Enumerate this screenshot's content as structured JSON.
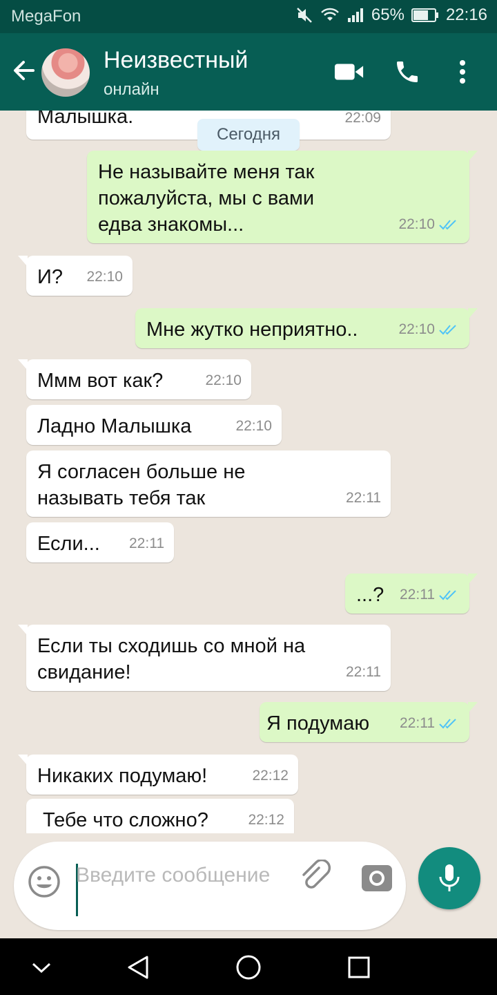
{
  "status_bar": {
    "carrier": "MegaFon",
    "battery": "65%",
    "time": "22:16"
  },
  "header": {
    "contact_name": "Неизвестный",
    "contact_status": "онлайн"
  },
  "chat": {
    "date_chip": "Сегодня",
    "messages": [
      {
        "dir": "in",
        "text": "Малышка.",
        "time": "22:09"
      },
      {
        "dir": "out",
        "text": "Не называйте меня так пожалуйста, мы с вами едва знакомы...",
        "time": "22:10"
      },
      {
        "dir": "in",
        "text": "И?",
        "time": "22:10"
      },
      {
        "dir": "out",
        "text": "Мне жутко неприятно..",
        "time": "22:10"
      },
      {
        "dir": "in",
        "text": "Ммм вот как?",
        "time": "22:10"
      },
      {
        "dir": "in",
        "text": "Ладно Малышка",
        "time": "22:10"
      },
      {
        "dir": "in",
        "text": "Я согласен больше не называть тебя так",
        "time": "22:11"
      },
      {
        "dir": "in",
        "text": "Если...",
        "time": "22:11"
      },
      {
        "dir": "out",
        "text": "...?",
        "time": "22:11"
      },
      {
        "dir": "in",
        "text": "Если ты сходишь со мной на свидание!",
        "time": "22:11"
      },
      {
        "dir": "out",
        "text": "Я подумаю",
        "time": "22:11"
      },
      {
        "dir": "in",
        "text": "Никаких подумаю!",
        "time": "22:12"
      },
      {
        "dir": "in",
        "text": "Тебе что сложно?",
        "time": "22:12"
      }
    ]
  },
  "composer": {
    "placeholder": "Введите сообщение"
  },
  "icons": {
    "back": "arrow-left-icon",
    "video": "video-call-icon",
    "call": "phone-icon",
    "more": "more-vert-icon",
    "emoji": "emoji-icon",
    "attach": "paperclip-icon",
    "camera": "camera-icon",
    "mic": "microphone-icon"
  },
  "colors": {
    "header": "#075e54",
    "status_bar": "#054d44",
    "outgoing_bubble": "#dcf8c6",
    "incoming_bubble": "#ffffff",
    "read_ticks": "#4fc3f7",
    "mic_button": "#128c7e"
  }
}
